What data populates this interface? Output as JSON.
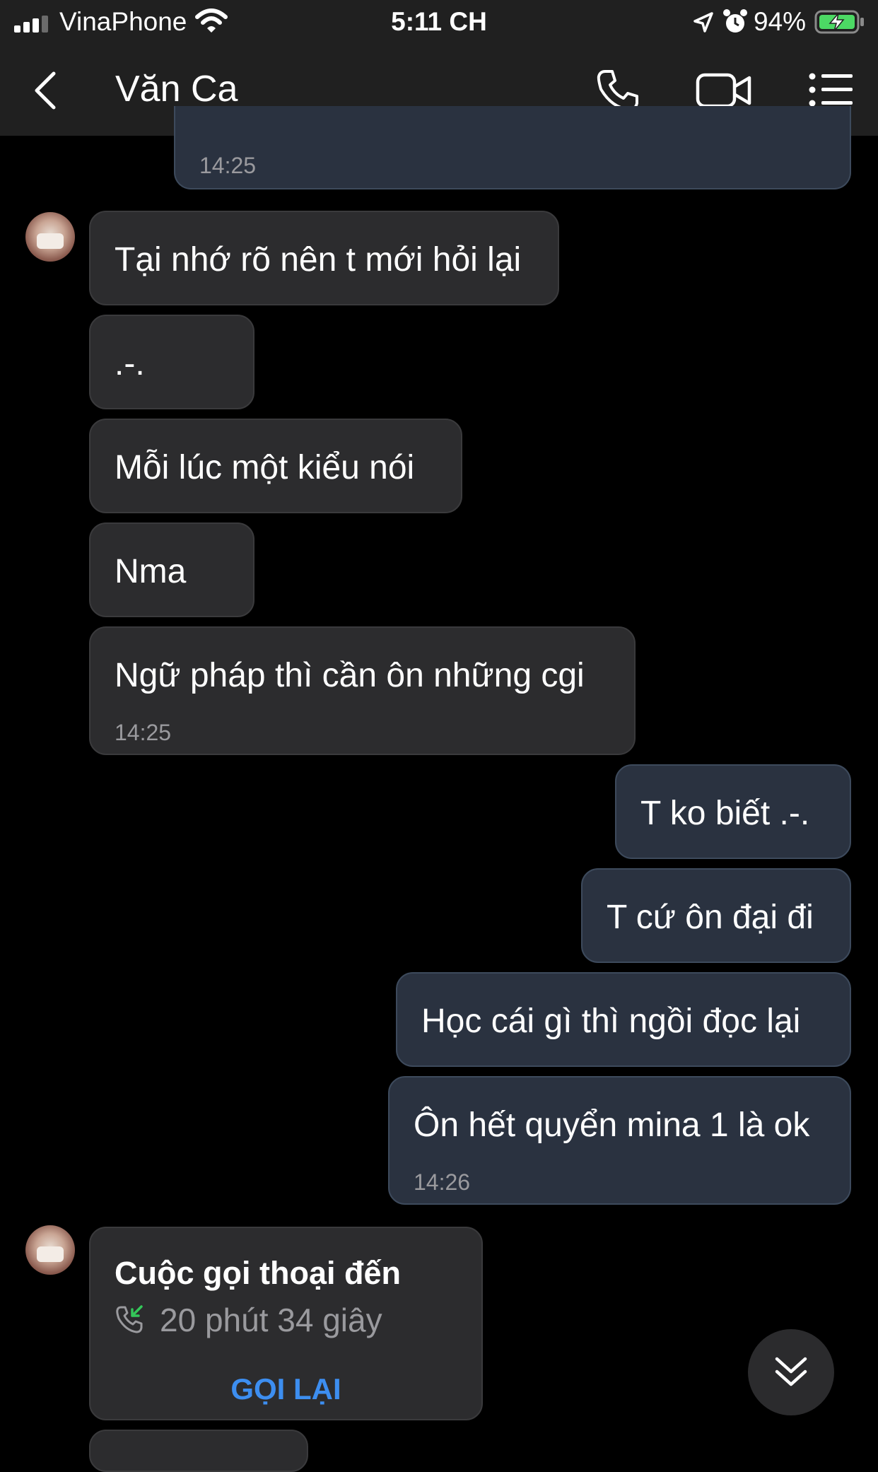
{
  "status_bar": {
    "carrier": "VinaPhone",
    "time": "5:11 CH",
    "battery": "94%"
  },
  "header": {
    "contact_name": "Văn Ca"
  },
  "messages": {
    "top_partial": {
      "time": "14:25"
    },
    "in_1": {
      "text": "Tại nhớ rõ nên t mới hỏi lại"
    },
    "in_2": {
      "text": ".-."
    },
    "in_3": {
      "text": "Mỗi lúc một kiểu nói"
    },
    "in_4": {
      "text": "Nma"
    },
    "in_5": {
      "text": "Ngữ pháp thì cần ôn những cgi",
      "time": "14:25"
    },
    "out_1": {
      "text": "T ko biết .-."
    },
    "out_2": {
      "text": "T cứ ôn đại đi"
    },
    "out_3": {
      "text": "Học cái gì thì ngồi đọc lại"
    },
    "out_4": {
      "text": "Ôn hết quyển mina 1 là ok",
      "time": "14:26"
    }
  },
  "call_card": {
    "title": "Cuộc gọi thoại đến",
    "duration": "20 phút 34 giây",
    "action": "GỌI LẠI",
    "action_color": "#3d8ef0",
    "icon": "incoming-call-icon"
  },
  "colors": {
    "background": "#000000",
    "bar": "#202020",
    "incoming_bubble": "#2c2c2e",
    "outgoing_bubble": "#2a3240"
  }
}
